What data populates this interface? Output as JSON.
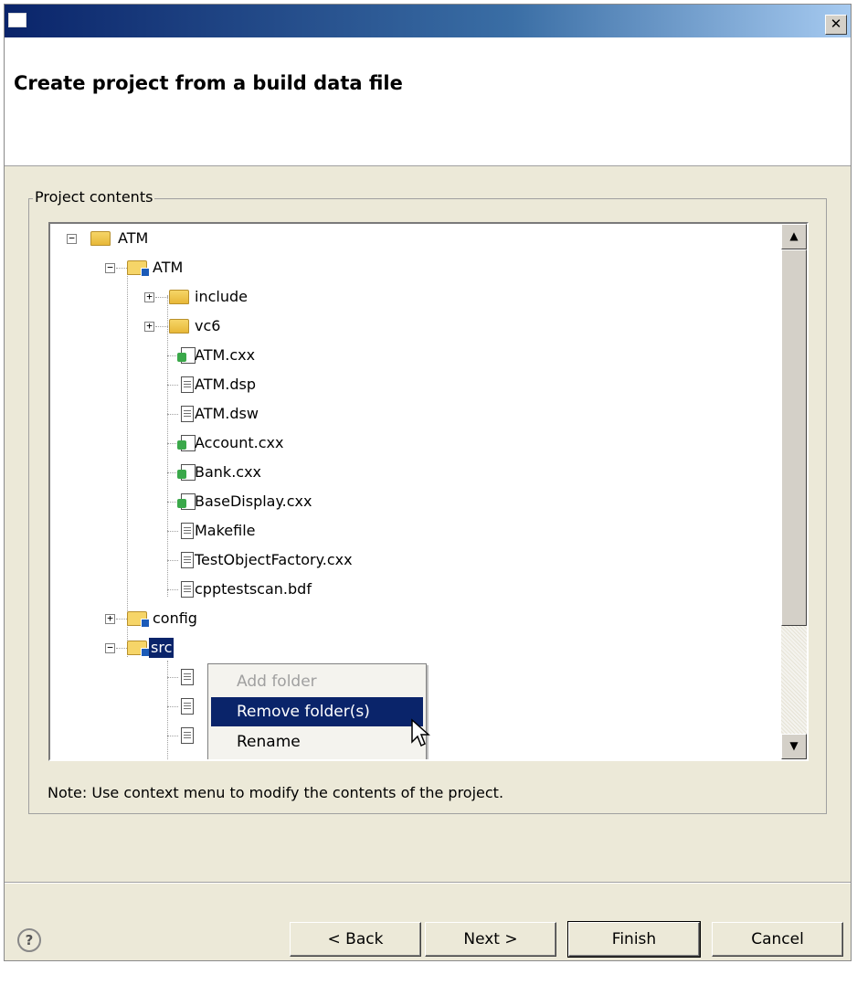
{
  "window": {
    "title": ""
  },
  "banner": {
    "title": "Create project from a build data file"
  },
  "group": {
    "legend": "Project contents"
  },
  "tree": {
    "rows": [
      {
        "label": "ATM",
        "kind": "project-root"
      },
      {
        "label": "ATM",
        "kind": "project"
      },
      {
        "label": "include",
        "kind": "folder"
      },
      {
        "label": "vc6",
        "kind": "folder"
      },
      {
        "label": "ATM.cxx",
        "kind": "c-file"
      },
      {
        "label": "ATM.dsp",
        "kind": "file"
      },
      {
        "label": "ATM.dsw",
        "kind": "file"
      },
      {
        "label": "Account.cxx",
        "kind": "c-file"
      },
      {
        "label": "Bank.cxx",
        "kind": "c-file"
      },
      {
        "label": "BaseDisplay.cxx",
        "kind": "c-file"
      },
      {
        "label": "Makefile",
        "kind": "file"
      },
      {
        "label": "TestObjectFactory.cxx",
        "kind": "file"
      },
      {
        "label": "cpptestscan.bdf",
        "kind": "file"
      },
      {
        "label": "config",
        "kind": "linked-folder"
      },
      {
        "label": "src",
        "kind": "linked-folder",
        "selected": true
      }
    ]
  },
  "context_menu": {
    "items": [
      {
        "label": "Add folder",
        "enabled": false
      },
      {
        "label": "Remove folder(s)",
        "enabled": true,
        "highlighted": true
      },
      {
        "label": "Rename",
        "enabled": true
      }
    ]
  },
  "note": "Note: Use context menu to modify the contents of the project.",
  "buttons": {
    "help": "?",
    "back": "< Back",
    "next": "Next >",
    "finish": "Finish",
    "cancel": "Cancel"
  },
  "colors": {
    "selection": "#0a246a",
    "dialog_bg": "#ece9d8",
    "title_gradient_start": "#0a246a"
  }
}
